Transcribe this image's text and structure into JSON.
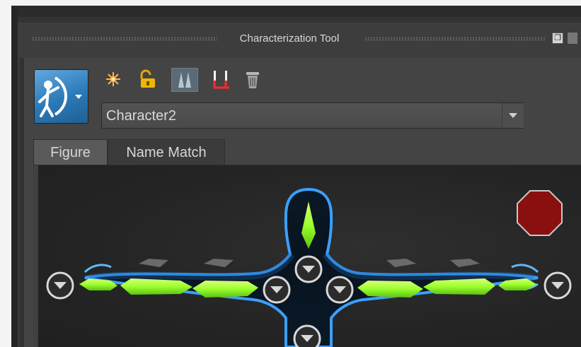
{
  "window": {
    "title": "Characterization Tool"
  },
  "toolbar": {
    "icons": [
      "character-menu-icon",
      "character-new-icon",
      "lock-icon",
      "skeleton-icon",
      "bone-align-icon",
      "trash-icon"
    ]
  },
  "character_select": {
    "value": "Character2"
  },
  "tabs": [
    {
      "label": "Figure",
      "active": true
    },
    {
      "label": "Name Match",
      "active": false
    }
  ],
  "colors": {
    "accent_blue": "#3aa0ff",
    "bone_green": "#9dff3c",
    "stop_red": "#8a1010",
    "bg_dark": "#242424"
  }
}
